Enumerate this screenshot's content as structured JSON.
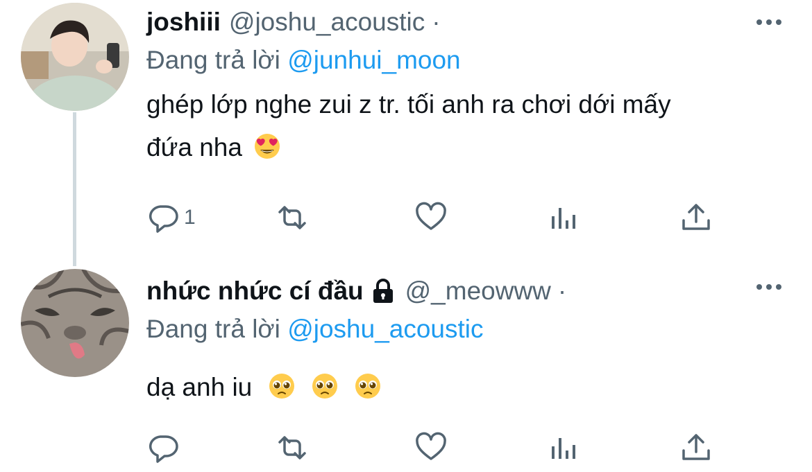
{
  "tweets": [
    {
      "display_name": "joshiii",
      "handle": "@joshu_acoustic",
      "separator": "·",
      "reply_prefix": "Đang trả lời",
      "reply_to": "@junhui_moon",
      "text_line1": "ghép lớp nghe zui z tr. tối anh ra chơi dới mấy",
      "text_line2": "đứa nha",
      "emojis": [
        "heart-eyes-emoji"
      ],
      "reply_count": "1",
      "verified_lock": false
    },
    {
      "display_name": "nhức nhức cí đầu",
      "handle": "@_meowww",
      "separator": "·",
      "reply_prefix": "Đang trả lời",
      "reply_to": "@joshu_acoustic",
      "text": "dạ anh iu",
      "emojis": [
        "pleading-face-emoji",
        "pleading-face-emoji",
        "pleading-face-emoji"
      ],
      "reply_count": "",
      "verified_lock": true
    }
  ],
  "colors": {
    "link": "#1d9bf0",
    "secondary_text": "#536471",
    "primary_text": "#0f1419",
    "thread_line": "#cfd9de"
  },
  "icons": [
    "reply-icon",
    "retweet-icon",
    "like-icon",
    "views-icon",
    "share-icon",
    "more-icon",
    "lock-icon"
  ]
}
